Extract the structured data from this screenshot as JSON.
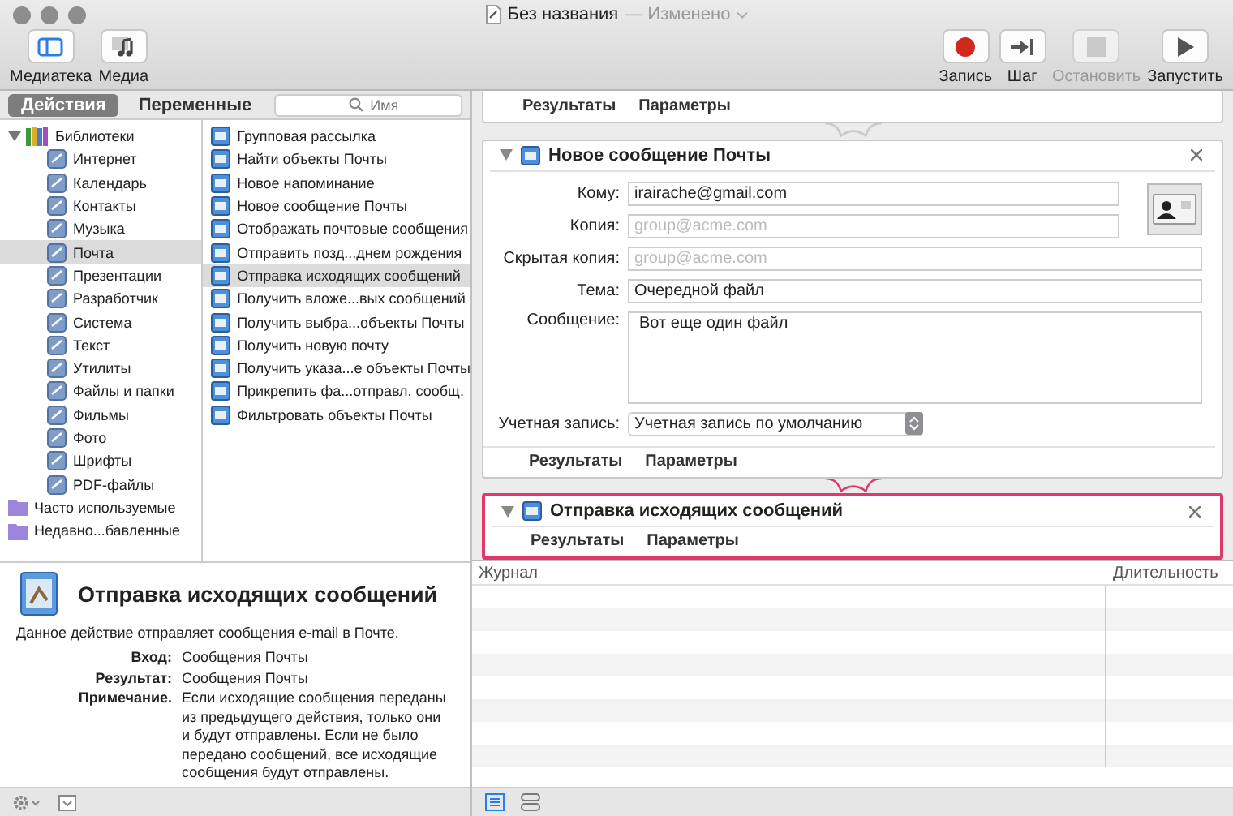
{
  "window": {
    "title": "Без названия",
    "status": "— Изменено"
  },
  "toolbar": {
    "left": [
      {
        "label": "Медиатека",
        "kind": "library",
        "selected": true
      },
      {
        "label": "Медиа",
        "kind": "media",
        "selected": false
      }
    ],
    "right": [
      {
        "label": "Запись",
        "kind": "record",
        "disabled": false
      },
      {
        "label": "Шаг",
        "kind": "step",
        "disabled": false
      },
      {
        "label": "Остановить",
        "kind": "stop",
        "disabled": true
      },
      {
        "label": "Запустить",
        "kind": "run",
        "disabled": false
      }
    ]
  },
  "sidebar": {
    "tabs": [
      {
        "label": "Действия",
        "selected": true
      },
      {
        "label": "Переменные",
        "selected": false
      }
    ],
    "search": {
      "placeholder": "Имя"
    },
    "libraries": {
      "label": "Библиотеки",
      "expanded": true,
      "children": [
        {
          "label": "Интернет",
          "selected": false
        },
        {
          "label": "Календарь",
          "selected": false
        },
        {
          "label": "Контакты",
          "selected": false
        },
        {
          "label": "Музыка",
          "selected": false
        },
        {
          "label": "Почта",
          "selected": true
        },
        {
          "label": "Презентации",
          "selected": false
        },
        {
          "label": "Разработчик",
          "selected": false
        },
        {
          "label": "Система",
          "selected": false
        },
        {
          "label": "Текст",
          "selected": false
        },
        {
          "label": "Утилиты",
          "selected": false
        },
        {
          "label": "Файлы и папки",
          "selected": false
        },
        {
          "label": "Фильмы",
          "selected": false
        },
        {
          "label": "Фото",
          "selected": false
        },
        {
          "label": "Шрифты",
          "selected": false
        },
        {
          "label": "PDF-файлы",
          "selected": false
        }
      ]
    },
    "folders": [
      {
        "label": "Часто используемые",
        "selected": false
      },
      {
        "label": "Недавно...бавленные",
        "selected": false
      }
    ],
    "actions": [
      {
        "label": "Групповая рассылка",
        "selected": false
      },
      {
        "label": "Найти объекты Почты",
        "selected": false
      },
      {
        "label": "Новое напоминание",
        "selected": false
      },
      {
        "label": "Новое сообщение Почты",
        "selected": false
      },
      {
        "label": "Отображать почтовые сообщения",
        "selected": false
      },
      {
        "label": "Отправить позд...днем рождения",
        "selected": false
      },
      {
        "label": "Отправка исходящих сообщений",
        "selected": true
      },
      {
        "label": "Получить вложе...вых сообщений",
        "selected": false
      },
      {
        "label": "Получить выбра...объекты Почты",
        "selected": false
      },
      {
        "label": "Получить новую почту",
        "selected": false
      },
      {
        "label": "Получить указа...е объекты Почты",
        "selected": false
      },
      {
        "label": "Прикрепить фа...отправл. сообщ.",
        "selected": false
      },
      {
        "label": "Фильтровать объекты Почты",
        "selected": false
      }
    ]
  },
  "description": {
    "title": "Отправка исходящих сообщений",
    "text": "Данное действие отправляет сообщения e-mail в Почте.",
    "fields": [
      {
        "label": "Вход:",
        "value": "Сообщения Почты"
      },
      {
        "label": "Результат:",
        "value": "Сообщения Почты"
      },
      {
        "label": "Примечание.",
        "value": "Если исходящие сообщения переданы из предыдущего действия, только они и будут отправлены. Если не было передано сообщений, все исходящие сообщения будут отправлены."
      }
    ]
  },
  "workflow": {
    "previous_tabs": [
      "Результаты",
      "Параметры"
    ],
    "cards": [
      {
        "title": "Новое сообщение Почты",
        "selected": false,
        "address_book_button": true,
        "fields": [
          {
            "label": "Кому:",
            "kind": "text",
            "value": "irairache@gmail.com"
          },
          {
            "label": "Копия:",
            "kind": "text",
            "placeholder": "group@acme.com"
          },
          {
            "label": "Скрытая копия:",
            "kind": "text",
            "placeholder": "group@acme.com"
          },
          {
            "label": "Тема:",
            "kind": "text",
            "value": "Очередной файл"
          },
          {
            "label": "Сообщение:",
            "kind": "textarea",
            "value": "Вот еще один файл"
          },
          {
            "label": "Учетная запись:",
            "kind": "select",
            "value": "Учетная запись по умолчанию"
          }
        ],
        "tabs": [
          "Результаты",
          "Параметры"
        ]
      },
      {
        "title": "Отправка исходящих сообщений",
        "selected": true,
        "tabs": [
          "Результаты",
          "Параметры"
        ]
      }
    ]
  },
  "log": {
    "columns": [
      "Журнал",
      "Длительность"
    ],
    "view_buttons": [
      {
        "kind": "list",
        "selected": true
      },
      {
        "kind": "split",
        "selected": false
      }
    ]
  }
}
